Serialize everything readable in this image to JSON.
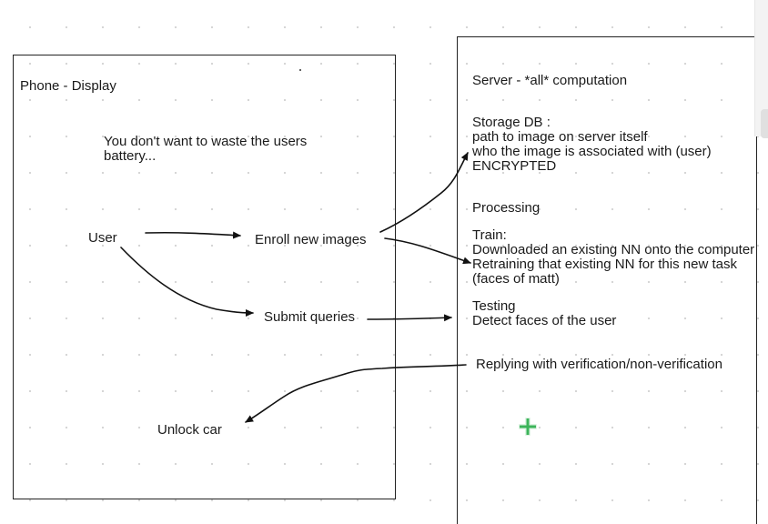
{
  "phone": {
    "title": "Phone - Display",
    "note": [
      "You don't want to waste the users",
      "battery..."
    ],
    "user": "User",
    "enroll": "Enroll new images",
    "submit": "Submit queries",
    "unlock": "Unlock car"
  },
  "server": {
    "title": "Server - *all* computation",
    "storage": [
      "Storage DB :",
      "path to image on server itself",
      "who the image is associated with (user)",
      "ENCRYPTED"
    ],
    "processing": "Processing",
    "train": [
      "Train:",
      "Downloaded an existing NN onto the computer",
      "Retraining that existing NN for this new task",
      "(faces of matt)"
    ],
    "testing": [
      "Testing",
      "Detect faces of the user"
    ],
    "reply": "Replying with verification/non-verification"
  },
  "colors": {
    "ink": "#111111",
    "grid_dot": "#d4d4d4",
    "cursor": "#3cb45a"
  },
  "icons": {
    "cursor": "plus-cursor-icon"
  }
}
